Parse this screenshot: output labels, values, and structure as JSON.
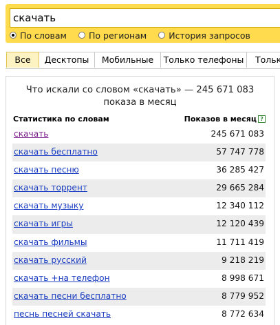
{
  "search": {
    "query": "скачать",
    "modes": [
      {
        "label": "По словам",
        "selected": true
      },
      {
        "label": "По регионам",
        "selected": false
      },
      {
        "label": "История запросов",
        "selected": false
      }
    ]
  },
  "tabs": [
    "Все",
    "Десктопы",
    "Мобильные",
    "Только телефоны",
    "Тольк"
  ],
  "panel": {
    "caption_line1": "Что искали со словом «скачать» — 245 671 083",
    "caption_line2": "показа в месяц",
    "col_left": "Статистика по словам",
    "col_right": "Показов в месяц",
    "help_icon": "?",
    "rows": [
      {
        "phrase": "скачать",
        "count": "245 671 083"
      },
      {
        "phrase": "скачать бесплатно",
        "count": "57 747 778"
      },
      {
        "phrase": "скачать песню",
        "count": "36 285 427"
      },
      {
        "phrase": "скачать торрент",
        "count": "29 665 284"
      },
      {
        "phrase": "скачать музыку",
        "count": "12 340 112"
      },
      {
        "phrase": "скачать игры",
        "count": "12 120 439"
      },
      {
        "phrase": "скачать фильмы",
        "count": "11 711 419"
      },
      {
        "phrase": "скачать русский",
        "count": "9 218 219"
      },
      {
        "phrase": "скачать +на телефон",
        "count": "8 998 671"
      },
      {
        "phrase": "скачать песни бесплатно",
        "count": "8 779 952"
      },
      {
        "phrase": "песнь песней скачать",
        "count": "8 772 634"
      }
    ]
  },
  "colors": {
    "search_bar": "#ffdb4d",
    "link": "#1a3dc1",
    "visited_link": "#7b1f8c",
    "row_alt": "#ececec",
    "active_tab": "#fdf3c2"
  }
}
